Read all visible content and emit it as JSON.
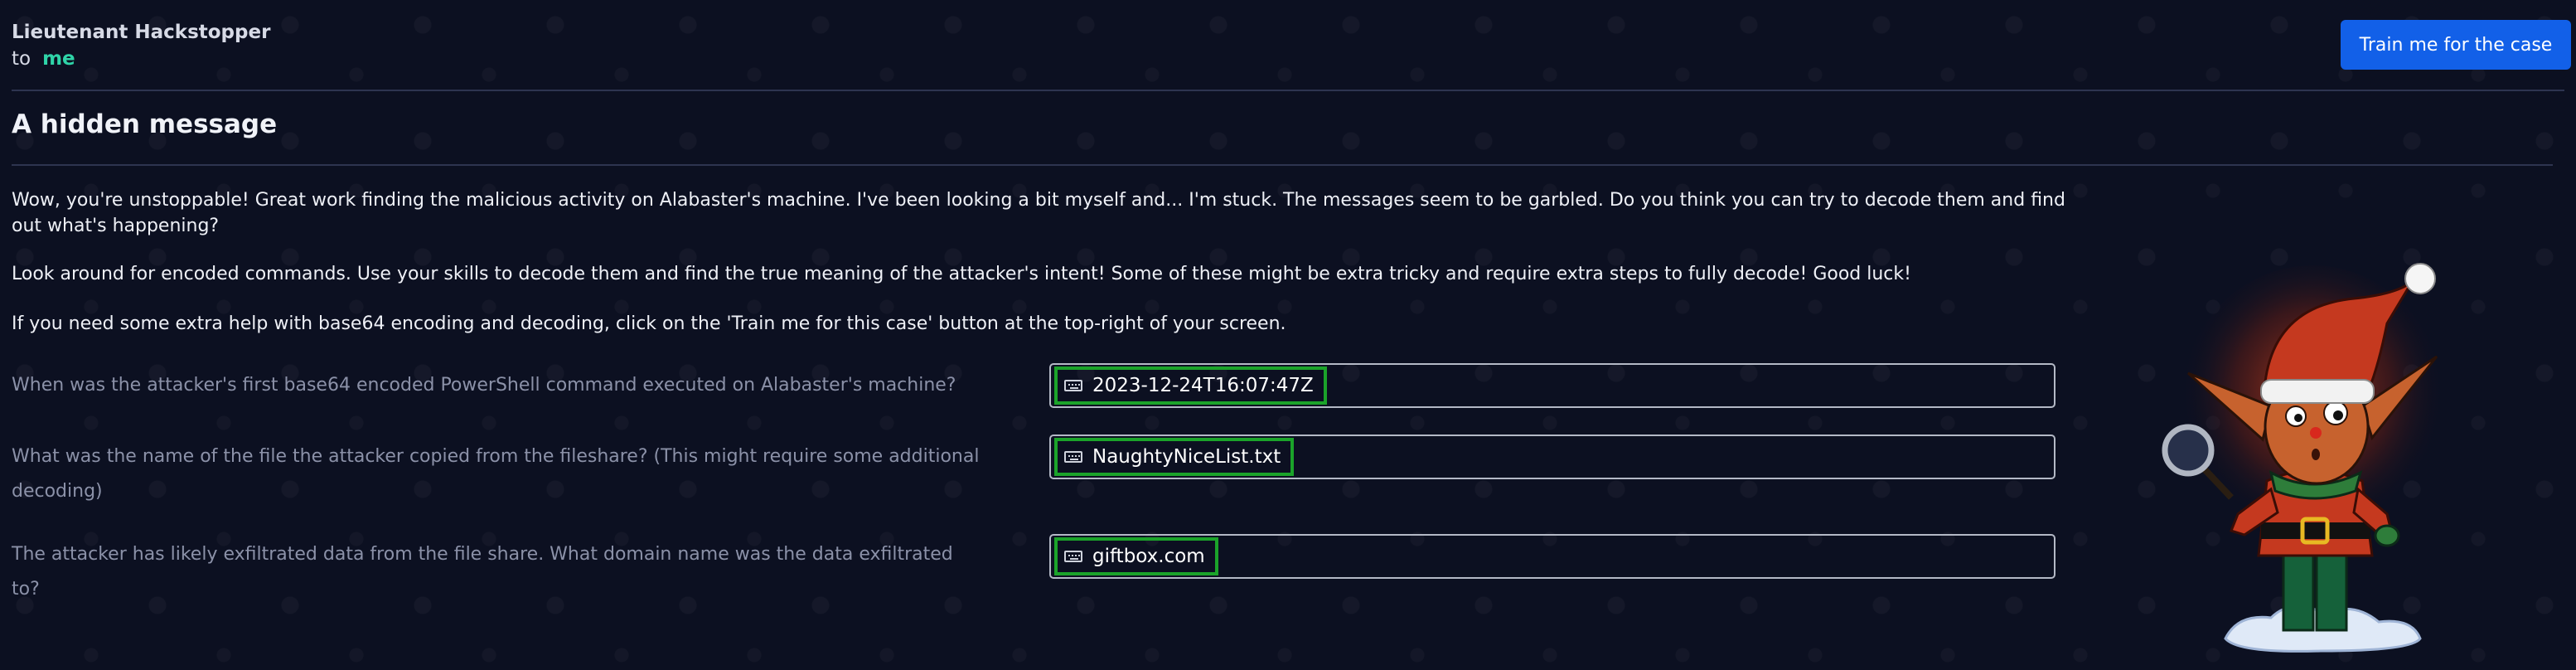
{
  "header": {
    "sender": "Lieutenant Hackstopper",
    "to_label": "to",
    "recipient": "me",
    "train_button": "Train me for the case"
  },
  "message": {
    "title": "A hidden message",
    "paragraphs": [
      "Wow, you're unstoppable! Great work finding the malicious activity on Alabaster's machine. I've been looking a bit myself and... I'm stuck. The messages seem to be garbled. Do you think you can try to decode them and find out what's happening?",
      "Look around for encoded commands. Use your skills to decode them and find the true meaning of the attacker's intent! Some of these might be extra tricky and require extra steps to fully decode! Good luck!",
      "If you need some extra help with base64 encoding and decoding, click on the 'Train me for this case' button at the top-right of your screen."
    ]
  },
  "questions": [
    {
      "question": "When was the attacker's first base64 encoded PowerShell command executed on Alabaster's machine?",
      "answer": "2023-12-24T16:07:47Z",
      "icon": "keyboard-icon"
    },
    {
      "question": "What was the name of the file the attacker copied from the fileshare? (This might require some additional decoding)",
      "answer": "NaughtyNiceList.txt",
      "icon": "keyboard-icon"
    },
    {
      "question": "The attacker has likely exfiltrated data from the file share. What domain name was the data exfiltrated to?",
      "answer": "giftbox.com",
      "icon": "keyboard-icon"
    }
  ],
  "colors": {
    "background": "#0c1021",
    "accent_button": "#1260e8",
    "recipient": "#2fd4a8",
    "answer_highlight": "#1ba32a"
  }
}
